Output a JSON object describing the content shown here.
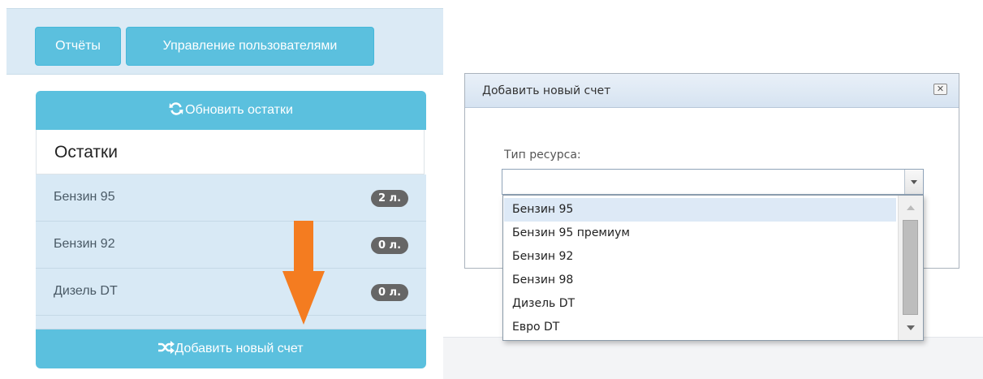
{
  "top_nav": {
    "reports_label": "Отчёты",
    "users_label": "Управление пользователями"
  },
  "balances": {
    "refresh_label": "Обновить остатки",
    "title": "Остатки",
    "items": [
      {
        "name": "Бензин 95",
        "badge": "2 л."
      },
      {
        "name": "Бензин 92",
        "badge": "0 л."
      },
      {
        "name": "Дизель DT",
        "badge": "0 л."
      }
    ],
    "add_label": "Добавить новый счет"
  },
  "dialog": {
    "title": "Добавить новый счет",
    "field_label": "Тип ресурса:",
    "select_value": "",
    "options": [
      "Бензин 95",
      "Бензин 95 премиум",
      "Бензин 92",
      "Бензин 98",
      "Дизель DT",
      "Евро DT"
    ],
    "highlighted_option": "Бензин 95"
  },
  "colors": {
    "button_blue": "#5bc0de",
    "list_bg": "#d8e9f5",
    "annotation_arrow": "#f47c20"
  },
  "icons": {
    "refresh": "refresh-icon",
    "shuffle": "shuffle-icon",
    "close": "close-icon",
    "arrow": "down-arrow-annotation"
  }
}
